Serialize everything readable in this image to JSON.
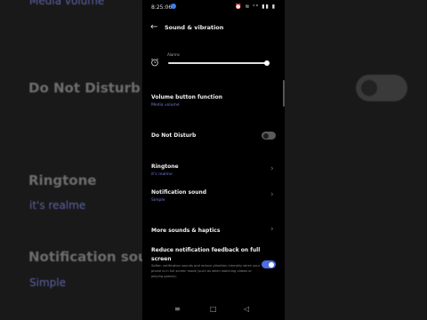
{
  "background": {
    "texts": [
      {
        "id": "dnd",
        "text": "Do Not Disturb"
      },
      {
        "id": "ringtone",
        "text": "Ringtone"
      },
      {
        "id": "ringtone_sub",
        "text": "it's realme"
      },
      {
        "id": "notif",
        "text": "Notification sou"
      },
      {
        "id": "notif_sub",
        "text": "Simple"
      },
      {
        "id": "top_sub",
        "text": "Media volume"
      }
    ]
  },
  "status_bar": {
    "time": "8:25:06",
    "icons": "⏰ ≋ ᵛᵒ ▮▮ ▮"
  },
  "header": {
    "back_icon": "←",
    "title": "Sound & vibration"
  },
  "alarm": {
    "label": "Alarms",
    "level": 0.97
  },
  "settings": {
    "volume_button": {
      "label": "Volume button function",
      "value": "Media volume"
    },
    "dnd": {
      "label": "Do Not Disturb",
      "enabled": false
    },
    "ringtone": {
      "label": "Ringtone",
      "value": "it's realme"
    },
    "notification_sound": {
      "label": "Notification sound",
      "value": "Simple"
    },
    "more_sounds": {
      "label": "More sounds & haptics"
    },
    "reduce_feedback": {
      "label_line1": "Reduce notification feedback on full",
      "label_line2": "screen",
      "description": "Soften notification sounds and reduce vibration intensity when your phone is in full screen mode (such as when watching videos or playing games).",
      "enabled": true
    }
  },
  "nav": {
    "menu": "≡",
    "home": "□",
    "back": "◁"
  },
  "colors": {
    "accent": "#4c6ee0",
    "subtext": "#6f7bd6"
  }
}
